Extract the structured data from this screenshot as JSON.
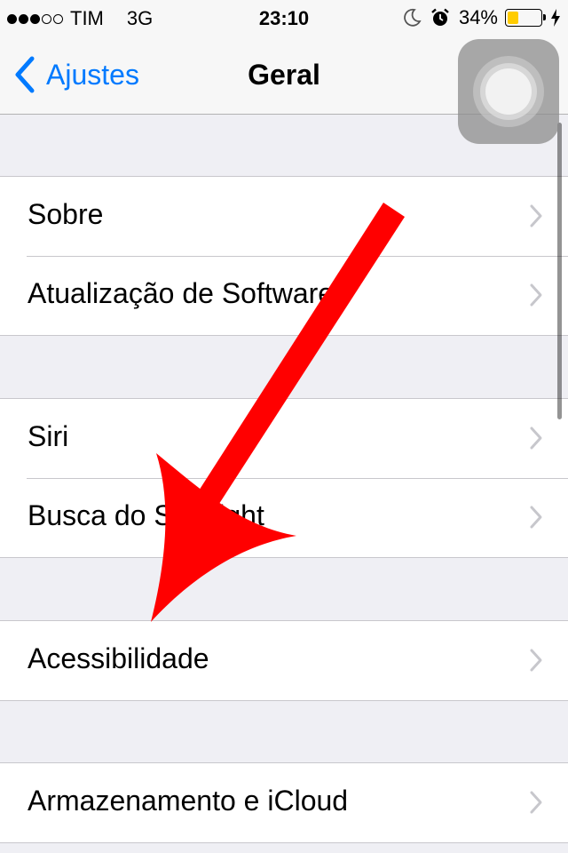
{
  "status_bar": {
    "signal_bars": 3,
    "signal_total": 5,
    "carrier": "TIM",
    "network": "3G",
    "time": "23:10",
    "battery_percent": "34%",
    "battery_level": 0.34,
    "battery_color": "#ffcc00",
    "icons": [
      "moon-icon",
      "alarm-icon",
      "battery-icon",
      "charging-bolt-icon"
    ]
  },
  "nav": {
    "back_label": "Ajustes",
    "title": "Geral",
    "accent_color": "#007aff"
  },
  "groups": [
    {
      "items": [
        {
          "label": "Sobre"
        },
        {
          "label": "Atualização de Software"
        }
      ]
    },
    {
      "items": [
        {
          "label": "Siri"
        },
        {
          "label": "Busca do Spotlight"
        }
      ]
    },
    {
      "items": [
        {
          "label": "Acessibilidade"
        }
      ]
    },
    {
      "items": [
        {
          "label": "Armazenamento e iCloud"
        }
      ]
    }
  ],
  "overlay": {
    "arrow_color": "#ff0000",
    "arrow_target": "Acessibilidade"
  }
}
